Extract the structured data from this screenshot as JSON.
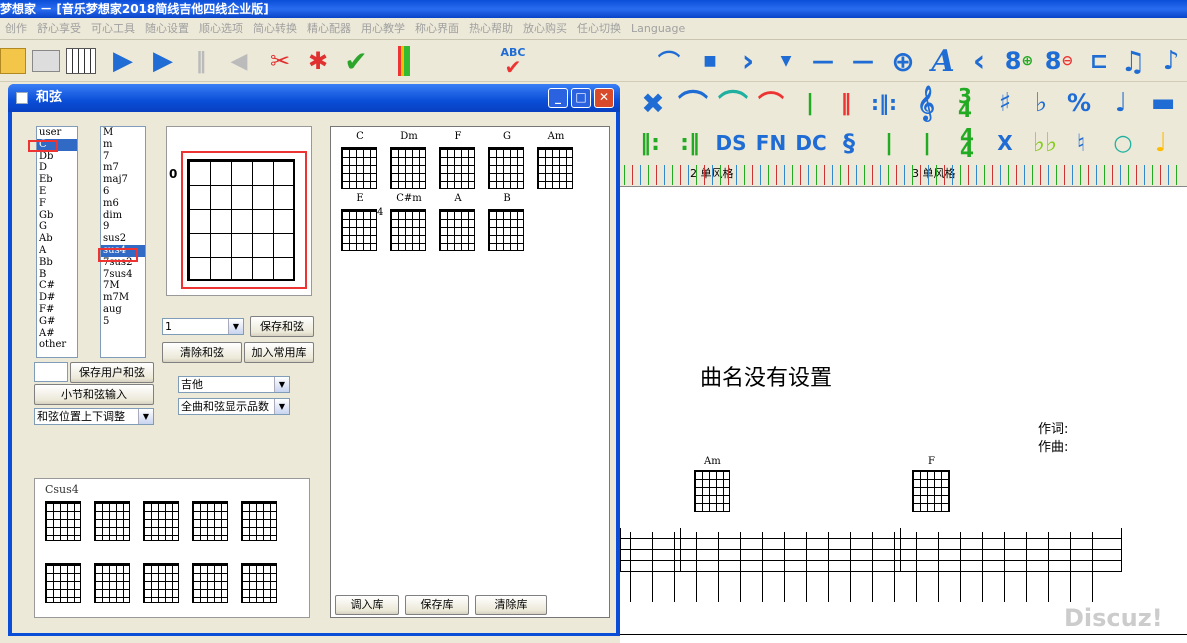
{
  "app": {
    "title": "梦想家 － [音乐梦想家2018简线吉他四线企业版]",
    "menu": [
      "创作",
      "舒心享受",
      "可心工具",
      "随心设置",
      "顺心选项",
      "简心转换",
      "精心配器",
      "用心教学",
      "称心界面",
      "热心帮助",
      "放心购买",
      "任心切换",
      "Language"
    ]
  },
  "toolbar": {
    "row3_labels": [
      "DS",
      "FN",
      "DC",
      "X"
    ],
    "icons_row1": [
      "folder-icon",
      "keyboard-icon",
      "piano-icon",
      "play-icon",
      "play-export-icon",
      "pause-icon",
      "back-icon",
      "cut-icon",
      "delete-icon",
      "check-icon",
      "level-icon",
      "abc-check-icon",
      "tie-icon",
      "fermata-icon",
      "staccato-icon",
      "accent-icon",
      "arrow-down-icon",
      "dash-icon",
      "long-dash-icon",
      "crosshair-icon",
      "text-icon",
      "decrescendo-icon",
      "add-bar-icon",
      "remove-bar-icon",
      "tuplet-icon",
      "note-icon"
    ]
  },
  "dialog": {
    "title": "和弦",
    "roots": [
      "user",
      "C",
      "Db",
      "D",
      "Eb",
      "E",
      "F",
      "Gb",
      "G",
      "Ab",
      "A",
      "Bb",
      "B",
      "C#",
      "D#",
      "F#",
      "G#",
      "A#",
      "other"
    ],
    "root_selected": "C",
    "types": [
      "M",
      "m",
      "7",
      "m7",
      "maj7",
      "6",
      "m6",
      "dim",
      "9",
      "sus2",
      "sus4",
      "7sus2",
      "7sus4",
      "7M",
      "m7M",
      "aug",
      "5"
    ],
    "type_selected": "sus4",
    "fret_label": "0",
    "fret_select": "1",
    "save_chord": "保存和弦",
    "clear_chord": "清除和弦",
    "add_common": "加入常用库",
    "save_user": "保存用户和弦",
    "bar_input": "小节和弦输入",
    "position_adjust": "和弦位置上下调整",
    "instrument": "吉他",
    "display_mode": "全曲和弦显示品数",
    "preview_title": "Csus4",
    "library": [
      "C",
      "Dm",
      "F",
      "G",
      "Am",
      "E",
      "C#m",
      "A",
      "B"
    ],
    "library_fret_marker": "4",
    "load_lib": "调入库",
    "save_lib": "保存库",
    "clear_lib": "清除库"
  },
  "score": {
    "measure_labels": [
      "2 单风格",
      "3 单风格"
    ],
    "title": "曲名没有设置",
    "lyricist": "作词:",
    "composer": "作曲:",
    "chords": [
      "Am",
      "F"
    ]
  },
  "watermark": "Discuz!"
}
